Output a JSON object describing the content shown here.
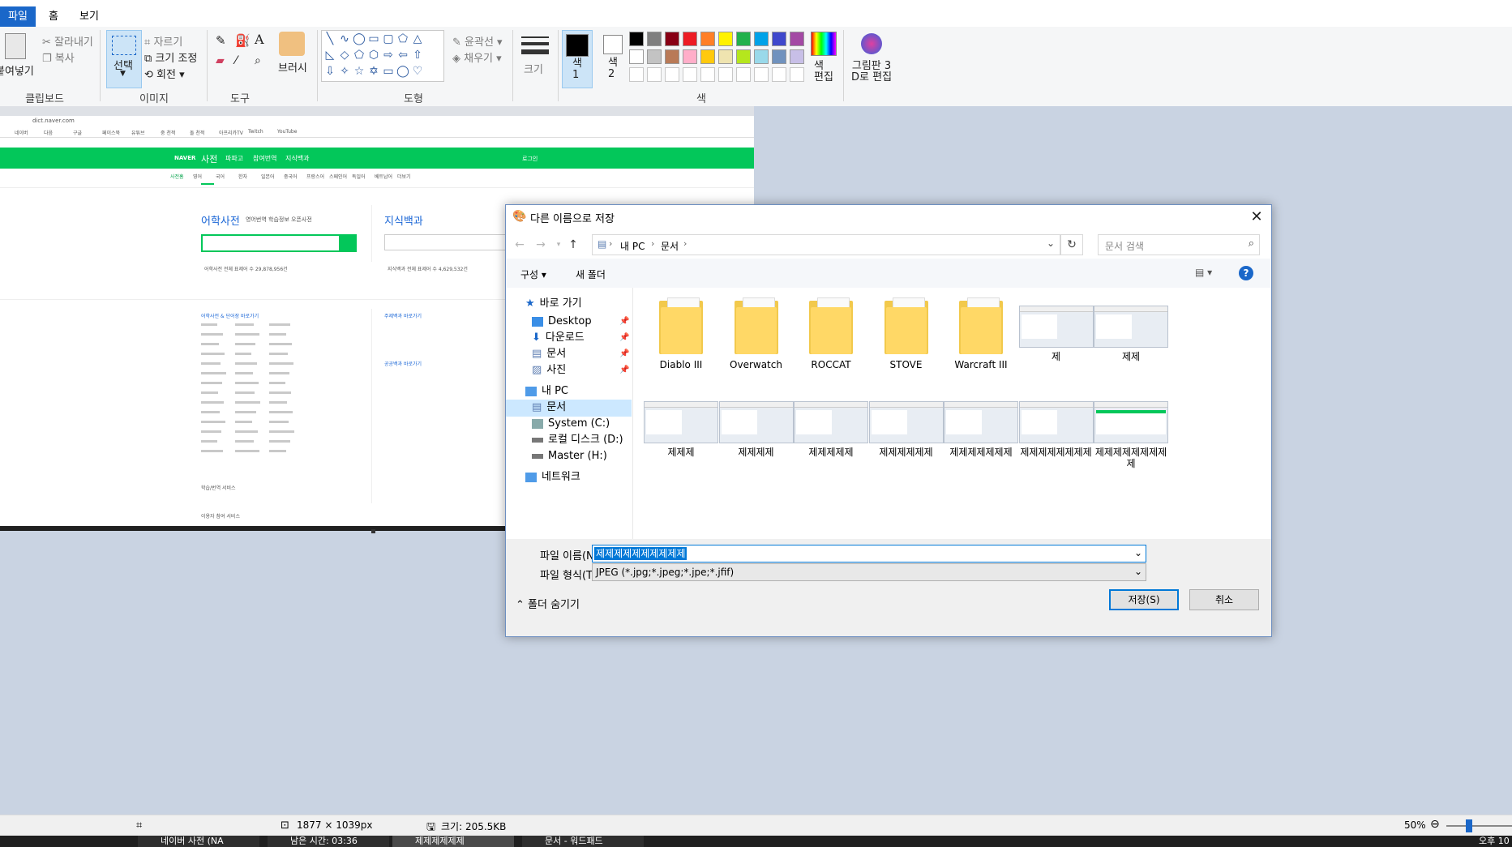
{
  "paint": {
    "menu": [
      "파일",
      "홈",
      "보기"
    ],
    "ribbon": {
      "clipboard": {
        "paste": "붙여넣기",
        "cut": "잘라내기",
        "copy": "복사",
        "label": "클립보드"
      },
      "image": {
        "select": "선택",
        "crop": "자르기",
        "resize": "크기 조정",
        "rotate": "회전",
        "label": "이미지"
      },
      "tools": {
        "label": "도구"
      },
      "brush": "브러시",
      "shapes": {
        "outline": "윤곽선",
        "fill": "채우기",
        "label": "도형"
      },
      "size": "크기",
      "color1": "색\n1",
      "color2": "색\n2",
      "edit_colors": "색\n편집",
      "paint3d": "그림판 3\nD로 편집",
      "colors_label": "색",
      "palette_row1": [
        "#000000",
        "#7f7f7f",
        "#880015",
        "#ed1c24",
        "#ff7f27",
        "#fff200",
        "#22b14c",
        "#00a2e8",
        "#3f48cc",
        "#a349a4"
      ],
      "palette_row2": [
        "#ffffff",
        "#c3c3c3",
        "#b97a57",
        "#ffaec9",
        "#ffc90e",
        "#efe4b0",
        "#b5e61d",
        "#99d9ea",
        "#7092be",
        "#c8bfe7"
      ]
    },
    "statusbar": {
      "dimensions": "1877 × 1039px",
      "size": "크기: 205.5KB",
      "zoom": "50%"
    }
  },
  "browser": {
    "url": "dict.naver.com",
    "bookmarks": [
      "네이버",
      "다음",
      "구글",
      "페이스북",
      "유튜브",
      "중 천적",
      "돌 천적",
      "아프리카TV",
      "Twitch",
      "YouTube"
    ],
    "naver": {
      "logo": "NAVER",
      "title": "사전",
      "nav": [
        "파파고",
        "참여번역",
        "지식백과"
      ],
      "login": "로그인"
    },
    "tabs": [
      "사전홈",
      "영어",
      "국어",
      "한자",
      "일본어",
      "중국어",
      "프랑스어",
      "스페인어",
      "독일어",
      "베트남어",
      "더보기"
    ],
    "dict_title": "어학사전",
    "dict_links": [
      "영어번역",
      "학습정보",
      "오픈사전"
    ],
    "enc_title": "지식백과",
    "dict_count": "어학사전 전체 표제어 수 29,878,956건",
    "enc_count": "지식백과 전체 표제어 수 4,629,532건",
    "sections": [
      "어학사전 & 단어장 바로가기",
      "주제백과 바로가기",
      "공공백과 바로가기",
      "학습/번역 서비스",
      "이용자 참여 서비스"
    ]
  },
  "dialog": {
    "title": "다른 이름으로 저장",
    "breadcrumb": [
      "내 PC",
      "문서"
    ],
    "search_placeholder": "문서 검색",
    "organize": "구성",
    "new_folder": "새 폴더",
    "nav": {
      "quick_access": "바로 가기",
      "desktop": "Desktop",
      "downloads": "다운로드",
      "documents": "문서",
      "pictures": "사진",
      "this_pc": "내 PC",
      "pc_documents": "문서",
      "system_c": "System (C:)",
      "local_d": "로컬 디스크 (D:)",
      "master_h": "Master (H:)",
      "network": "네트워크"
    },
    "files": [
      "Diablo III",
      "Overwatch",
      "ROCCAT",
      "STOVE",
      "Warcraft III",
      "제",
      "제제",
      "제제제",
      "제제제제",
      "제제제제제",
      "제제제제제제",
      "제제제제제제제",
      "제제제제제제제제",
      "제제제제제제제제제"
    ],
    "filename_label": "파일 이름(N):",
    "filename_value": "제제제제제제제제제제",
    "filetype_label": "파일 형식(T):",
    "filetype_value": "JPEG (*.jpg;*.jpeg;*.jpe;*.jfif)",
    "hide_folders": "폴더 숨기기",
    "save": "저장(S)",
    "cancel": "취소"
  },
  "taskbar": {
    "items": [
      "네이버 사전 (NA",
      "남은 시간: 03:36",
      "제제제제제제",
      "문서 - 워드패드"
    ],
    "clock": "오후 10"
  }
}
